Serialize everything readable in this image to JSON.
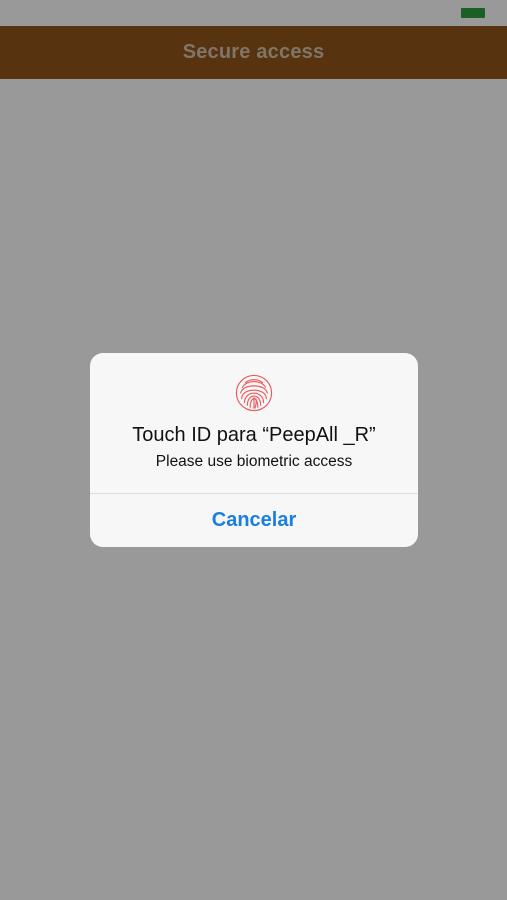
{
  "status_bar": {
    "battery_icon": "battery-icon",
    "battery_color": "#2e9e3f"
  },
  "nav_bar": {
    "title": "Secure access",
    "background_color": "#91561c"
  },
  "alert": {
    "icon": "fingerprint-icon",
    "icon_color": "#f0565c",
    "title": "Touch ID para “PeepAll _R”",
    "message": "Please use biometric access",
    "cancel_label": "Cancelar",
    "cancel_color": "#1a7fe0"
  }
}
